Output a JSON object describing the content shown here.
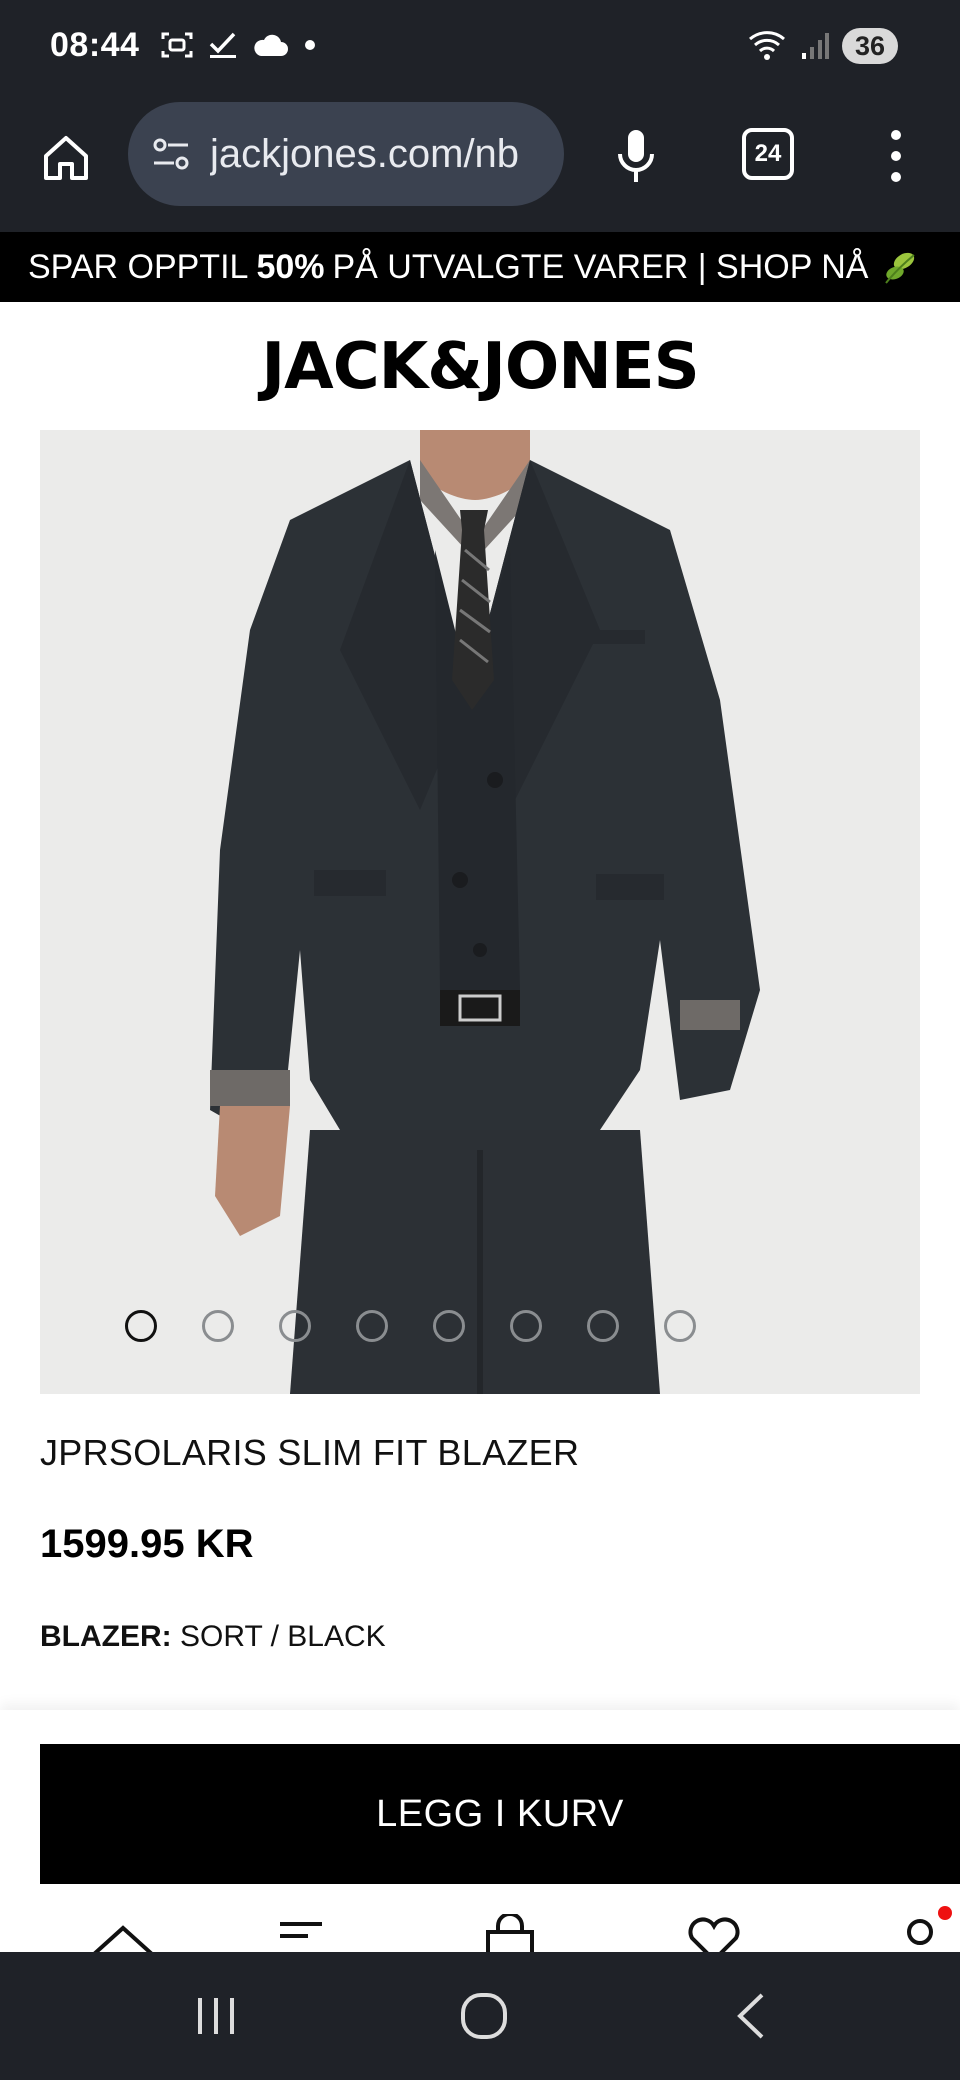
{
  "status_bar": {
    "time": "08:44",
    "battery": "36",
    "left_icons": [
      "screenshot-icon",
      "check-icon",
      "cloud-icon",
      "dot-icon"
    ],
    "right_icons": [
      "wifi-icon",
      "signal-icon"
    ]
  },
  "browser": {
    "url": "jackjones.com/nb",
    "tab_count": "24"
  },
  "promo": {
    "text_before": "SPAR OPPTIL",
    "highlight": "50%",
    "text_after": "PÅ UTVALGTE VARER | SHOP NÅ"
  },
  "brand": {
    "logo": "JACK&JONES"
  },
  "product": {
    "image_count": 8,
    "active_image": 1,
    "title": "JPRSOLARIS SLIM FIT BLAZER",
    "price": "1599.95 KR",
    "color_label": "BLAZER:",
    "color_value": "SORT / BLACK"
  },
  "actions": {
    "add_to_cart": "LEGG I KURV"
  },
  "colors": {
    "chrome": "#1f2228",
    "url_pill": "#3b4250",
    "cta": "#000000",
    "notification": "#e11111"
  }
}
